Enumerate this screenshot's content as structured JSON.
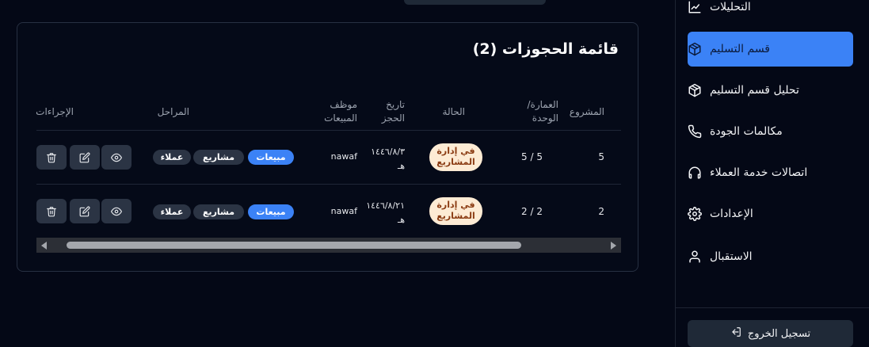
{
  "sidebar": {
    "items": [
      {
        "label": "التحليلات",
        "icon": "chart-line-icon"
      },
      {
        "label": "قسم التسليم",
        "icon": "package-icon",
        "active": true
      },
      {
        "label": "تحليل قسم التسليم",
        "icon": "package-icon"
      },
      {
        "label": "مكالمات الجودة",
        "icon": "phone-icon"
      },
      {
        "label": "اتصالات خدمة العملاء",
        "icon": "headphones-icon"
      },
      {
        "label": "الإعدادات",
        "icon": "gear-icon"
      },
      {
        "label": "الاستقبال",
        "icon": "user-icon"
      }
    ],
    "logout_label": "تسجيل الخروج",
    "accent_color": "#3b82f6"
  },
  "bookings": {
    "title": "قائمة الحجوزات (2)",
    "columns": {
      "project": "المشروع",
      "unit_line1": "العمارة/",
      "unit_line2": "الوحدة",
      "status": "الحالة",
      "date_line1": "تاريخ",
      "date_line2": "الحجز",
      "agent_line1": "موظف",
      "agent_line2": "المبيعات",
      "stages": "المراحل",
      "actions": "الإجراءات"
    },
    "rows": [
      {
        "project": "5",
        "unit": "5 / 5",
        "status_line1": "في إدارة",
        "status_line2": "المشاريع",
        "date_line1": "١٤٤٦/٨/٣",
        "date_line2": "هـ",
        "agent": "nawaf",
        "stages": [
          "مبيعات",
          "مشاريع",
          "عملاء"
        ]
      },
      {
        "project": "2",
        "unit": "2 / 2",
        "status_line1": "في إدارة",
        "status_line2": "المشاريع",
        "date_line1": "١٤٤٦/٨/٢١",
        "date_line2": "هـ",
        "agent": "nawaf",
        "stages": [
          "مبيعات",
          "مشاريع",
          "عملاء"
        ]
      }
    ],
    "status_color": "#fdebd4"
  }
}
